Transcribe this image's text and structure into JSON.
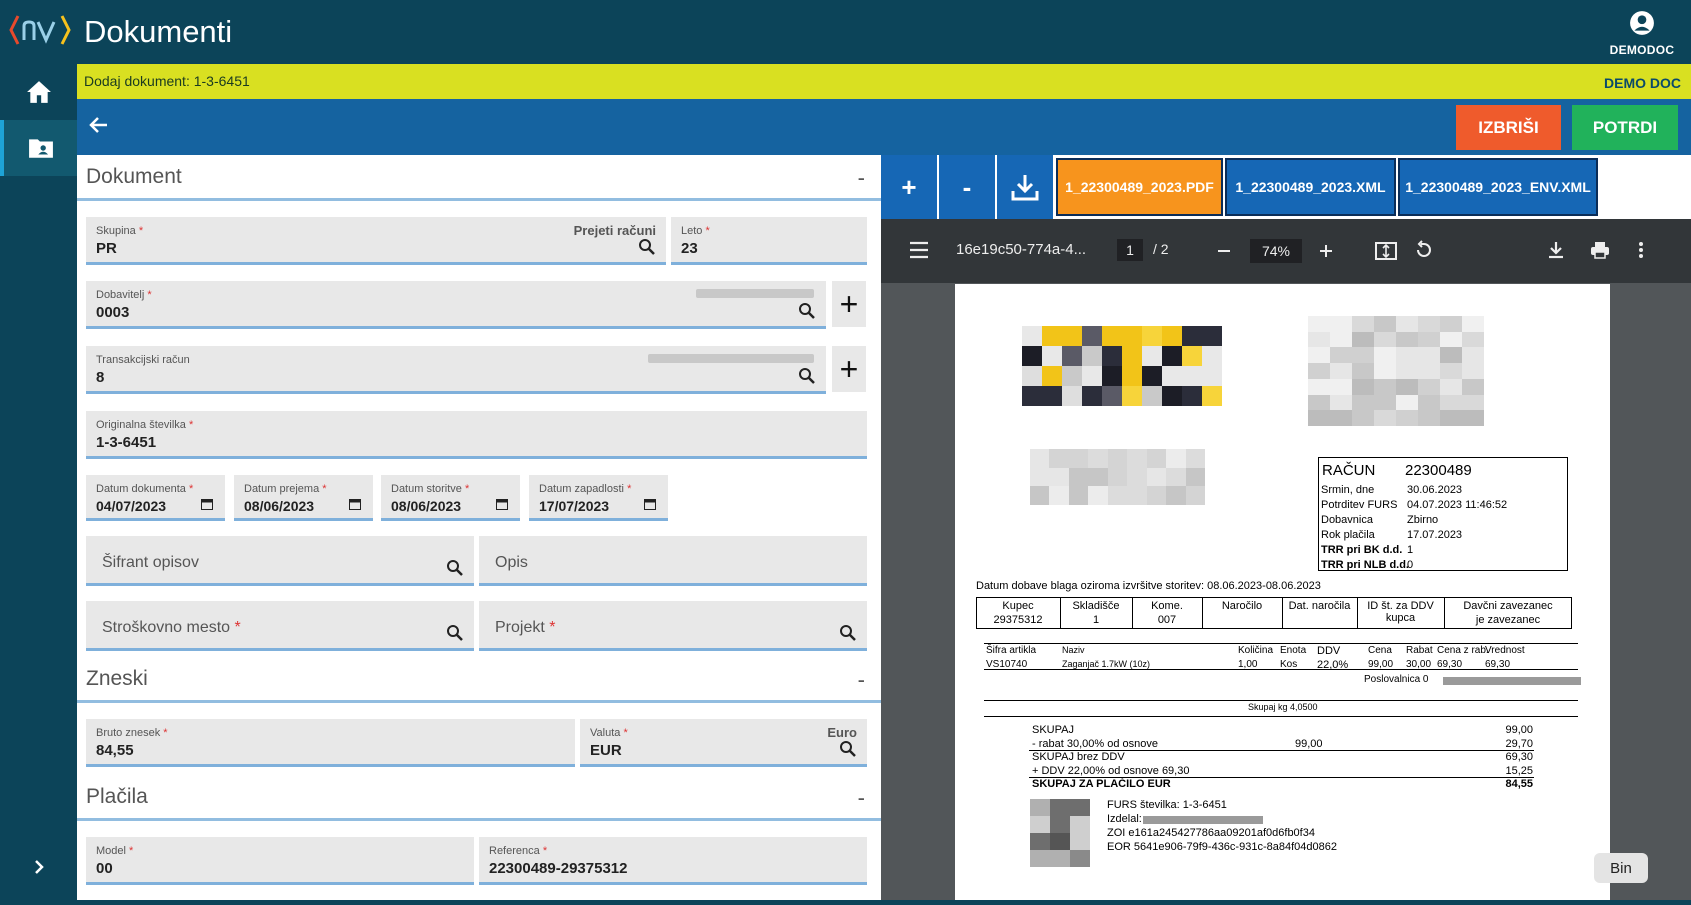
{
  "app": {
    "title": "Dokumenti",
    "user": "DEMODOC"
  },
  "banner": {
    "left": "Dodaj dokument: 1-3-6451",
    "right": "DEMO DOC"
  },
  "actions": {
    "delete": "IZBRIŠI",
    "confirm": "POTRDI"
  },
  "sections": {
    "dokument": "Dokument",
    "zneski": "Zneski",
    "placila": "Plačila",
    "collapse": "-"
  },
  "fields": {
    "skupina": {
      "label": "Skupina",
      "value": "PR",
      "extra": "Prejeti računi"
    },
    "leto": {
      "label": "Leto",
      "value": "23"
    },
    "dobavitelj": {
      "label": "Dobavitelj",
      "value": "0003"
    },
    "trr": {
      "label": "Transakcijski račun",
      "value": "8"
    },
    "orig": {
      "label": "Originalna številka",
      "value": "1-3-6451"
    },
    "datum_dok": {
      "label": "Datum dokumenta",
      "value": "04/07/2023"
    },
    "datum_prej": {
      "label": "Datum prejema",
      "value": "08/06/2023"
    },
    "datum_stor": {
      "label": "Datum storitve",
      "value": "08/06/2023"
    },
    "datum_zap": {
      "label": "Datum zapadlosti",
      "value": "17/07/2023"
    },
    "sifrant": {
      "placeholder": "Šifrant opisov"
    },
    "opis": {
      "placeholder": "Opis"
    },
    "strosk": {
      "placeholder": "Stroškovno mesto"
    },
    "projekt": {
      "placeholder": "Projekt"
    },
    "bruto": {
      "label": "Bruto znesek",
      "value": "84,55"
    },
    "valuta": {
      "label": "Valuta",
      "value": "EUR",
      "extra": "Euro"
    },
    "model": {
      "label": "Model",
      "value": "00"
    },
    "referenca": {
      "label": "Referenca",
      "value": "22300489-29375312"
    },
    "required_mark": "*"
  },
  "toolbar": {
    "plus": "+",
    "minus": "-"
  },
  "files": [
    "1_22300489_2023.PDF",
    "1_22300489_2023.XML",
    "1_22300489_2023_ENV.XML"
  ],
  "colors": {
    "active_file": "#f7941d",
    "file": "#1667b5"
  },
  "viewer": {
    "filename": "16e19c50-774a-4...",
    "page": "1",
    "pages": "/  2",
    "zoom": "74%"
  },
  "invoice": {
    "title": "RAČUN",
    "number": "22300489",
    "meta": [
      {
        "k": "Srmin, dne",
        "v": "30.06.2023"
      },
      {
        "k": "Potrditev FURS",
        "v": "04.07.2023 11:46:52"
      },
      {
        "k": "Dobavnica",
        "v": "Zbirno"
      },
      {
        "k": "Rok plačila",
        "v": "17.07.2023"
      },
      {
        "k": "TRR pri BK d.d.",
        "v": "1"
      },
      {
        "k": "TRR pri NLB d.d.",
        "v": "0"
      }
    ],
    "delivery": "Datum dobave blaga oziroma izvršitve storitev: 08.06.2023-08.06.2023",
    "hdr": {
      "kupec": "Kupec",
      "skladisce": "Skladišče",
      "kome": "Kome.",
      "narocilo": "Naročilo",
      "dat_narocila": "Dat. naročila",
      "id_ddv": "ID št. za DDV kupca",
      "davcni": "Davčni zavezanec"
    },
    "row": {
      "kupec": "29375312",
      "skladisce": "1",
      "kome": "007",
      "davcni": "je zavezanec"
    },
    "items_hdr": {
      "sifra": "Šifra artikla",
      "naziv": "Naziv",
      "kolicina": "Količina",
      "enota": "Enota",
      "ddv": "DDV",
      "cena": "Cena",
      "rabat": "Rabat",
      "cena_z_rab": "Cena z rab.",
      "vrednost": "Vrednost"
    },
    "item": {
      "sifra": "VS10740",
      "naziv": "Zaganjač 1.7kW (10z)",
      "kolicina": "1,00",
      "enota": "Kos",
      "ddv": "22,0%",
      "cena": "99,00",
      "rabat": "30,00",
      "cena_z_rab": "69,30",
      "vrednost": "69,30"
    },
    "poslovalnica": "Poslovalnica 0",
    "skupaj_kg": "Skupaj kg  4,0500",
    "totals": [
      {
        "k": "SKUPAJ",
        "m": "",
        "v": "99,00"
      },
      {
        "k": "- rabat 30,00% od osnove",
        "m": "99,00",
        "v": "29,70"
      },
      {
        "k": "SKUPAJ brez DDV",
        "m": "",
        "v": "69,30"
      },
      {
        "k": "+ DDV 22,00% od osnove 69,30",
        "m": "",
        "v": "15,25"
      },
      {
        "k": "SKUPAJ ZA PLAČILO EUR",
        "m": "",
        "v": "84,55"
      }
    ],
    "furs": "FURS številka: 1-3-6451",
    "izdelal": "Izdelal:",
    "zoi": "ZOI e161a245427786aa09201af0d6fb0f34",
    "eor": "EOR 5641e906-79f9-436c-931c-8a84f04d0862"
  },
  "tooltip": "Bin"
}
